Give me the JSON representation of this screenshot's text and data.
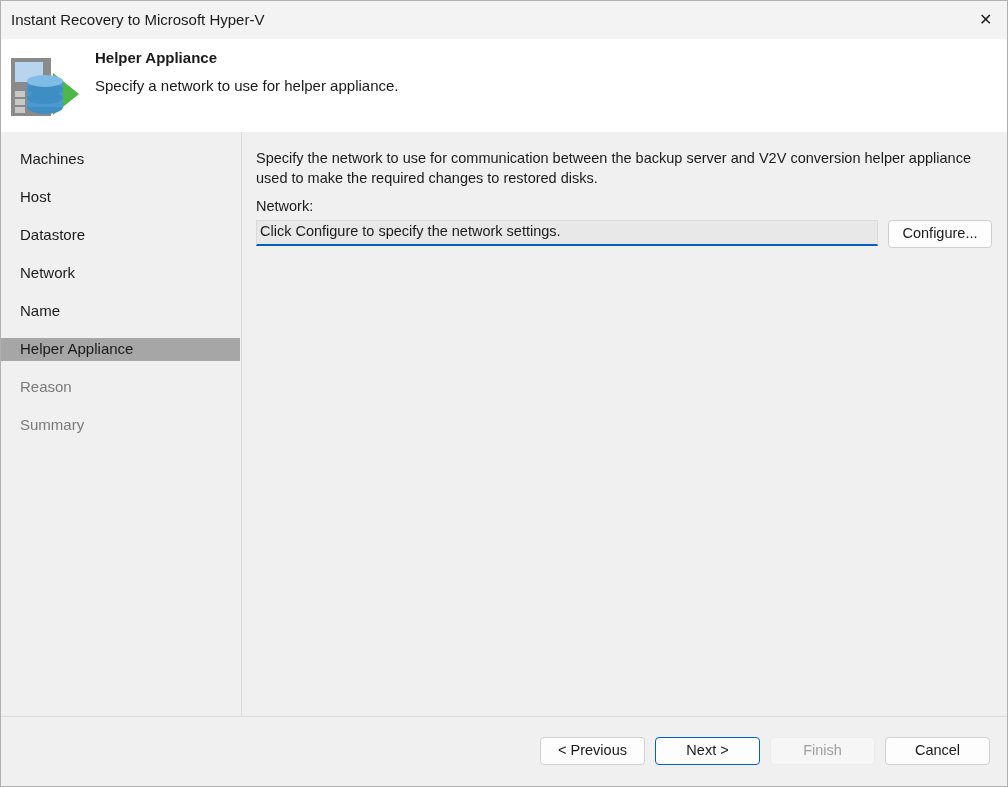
{
  "window": {
    "title": "Instant Recovery to Microsoft Hyper-V",
    "close": "✕"
  },
  "header": {
    "title": "Helper Appliance",
    "subtitle": "Specify a network to use for helper appliance."
  },
  "steps": [
    {
      "label": "Machines",
      "selected": false,
      "disabled": false
    },
    {
      "label": "Host",
      "selected": false,
      "disabled": false
    },
    {
      "label": "Datastore",
      "selected": false,
      "disabled": false
    },
    {
      "label": "Network",
      "selected": false,
      "disabled": false
    },
    {
      "label": "Name",
      "selected": false,
      "disabled": false
    },
    {
      "label": "Helper Appliance",
      "selected": true,
      "disabled": false
    },
    {
      "label": "Reason",
      "selected": false,
      "disabled": true
    },
    {
      "label": "Summary",
      "selected": false,
      "disabled": true
    }
  ],
  "content": {
    "description": "Specify the network to use for communication between the backup server and V2V conversion helper appliance used to make the required changes to restored disks.",
    "network_label": "Network:",
    "network_value": "Click Configure to specify the network settings.",
    "configure_button": "Configure..."
  },
  "buttons": [
    {
      "label": "< Previous",
      "default": false,
      "disabled": false
    },
    {
      "label": "Next >",
      "default": true,
      "disabled": false
    },
    {
      "label": "Finish",
      "default": false,
      "disabled": true
    },
    {
      "label": "Cancel",
      "default": false,
      "disabled": false
    }
  ]
}
